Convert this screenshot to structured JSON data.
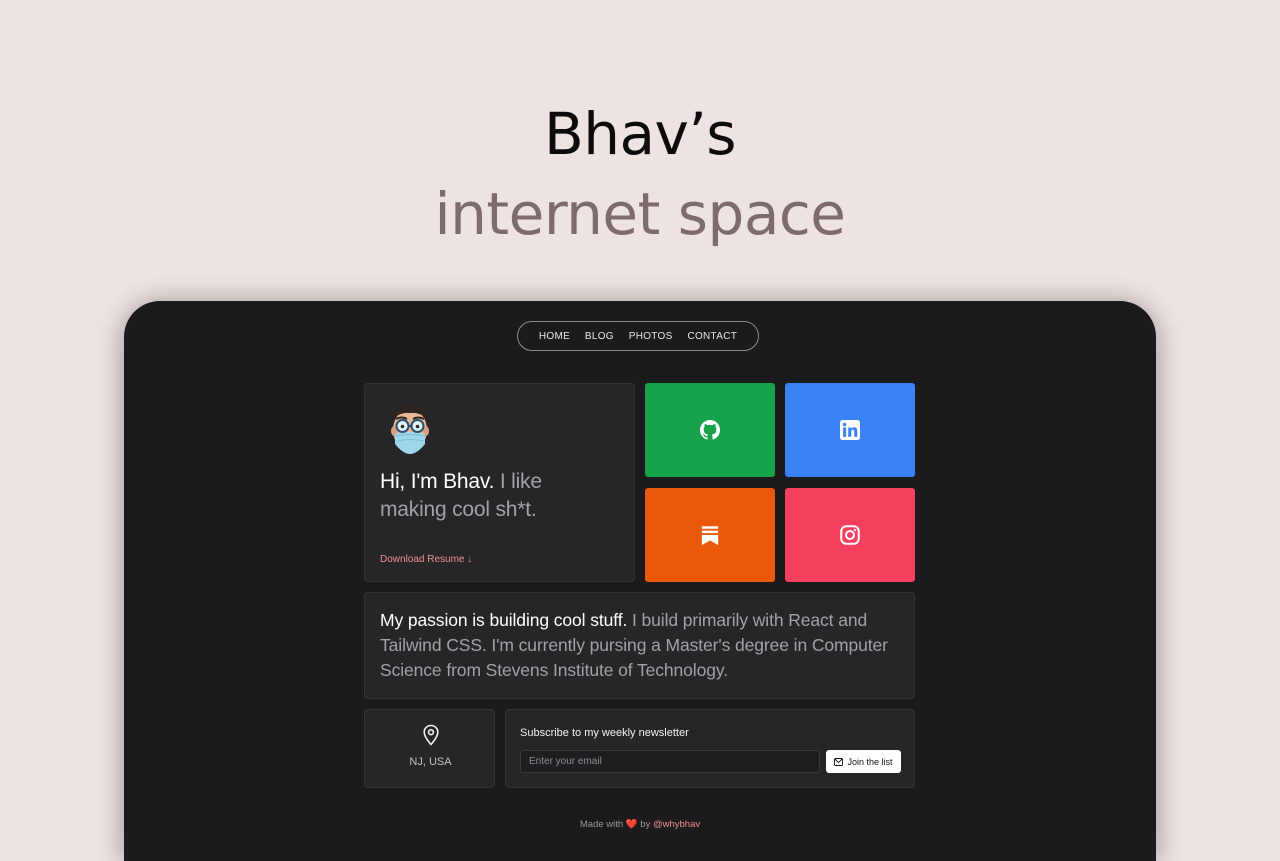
{
  "hero": {
    "line1": "Bhav’s",
    "line2": "internet space"
  },
  "nav": {
    "items": [
      {
        "label": "HOME"
      },
      {
        "label": "BLOG"
      },
      {
        "label": "PHOTOS"
      },
      {
        "label": "CONTACT"
      }
    ]
  },
  "intro": {
    "greeting": "Hi, I'm Bhav.",
    "tagline": " I like making cool sh*t.",
    "resume_link": "Download Resume ↓"
  },
  "social": [
    {
      "name": "github",
      "icon": "github-icon",
      "color": "#17a34a"
    },
    {
      "name": "linkedin",
      "icon": "linkedin-icon",
      "color": "#3b82f6"
    },
    {
      "name": "substack",
      "icon": "substack-icon",
      "color": "#ea580c"
    },
    {
      "name": "instagram",
      "icon": "instagram-icon",
      "color": "#f43f5e"
    }
  ],
  "about": {
    "lead": "My passion is building cool stuff.",
    "body": " I build primarily with React and Tailwind CSS. I'm currently pursing a Master's degree in Computer Science from Stevens Institute of Technology."
  },
  "location": {
    "icon": "map-pin-icon",
    "text": "NJ, USA"
  },
  "newsletter": {
    "title": "Subscribe to my weekly newsletter",
    "placeholder": "Enter your email",
    "button": "Join the list",
    "button_icon": "mail-icon"
  },
  "footer": {
    "prefix": "Made with ",
    "heart": "❤️",
    "middle": " by ",
    "handle": "@whybhav"
  },
  "colors": {
    "background": "#ede3e1",
    "device": "#1b1a1c",
    "card": "#262528",
    "accent_link": "#f08f93"
  }
}
